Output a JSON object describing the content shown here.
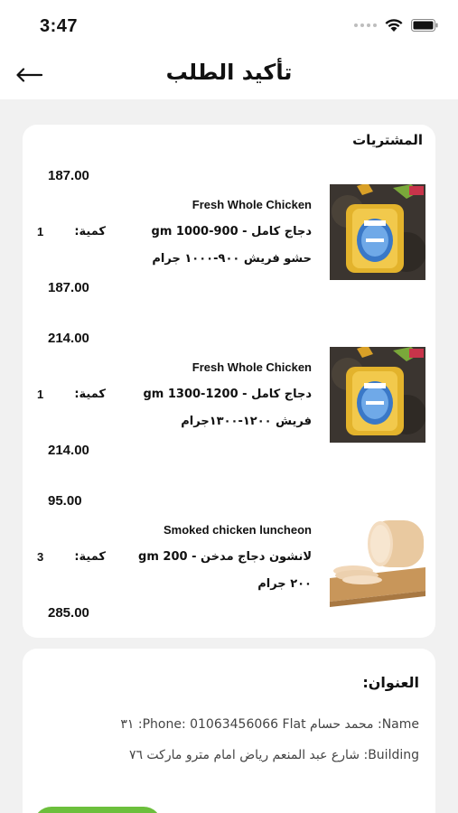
{
  "status_bar": {
    "time": "3:47"
  },
  "header": {
    "title": "تأكيد الطلب"
  },
  "products_section": {
    "title": "المشتريات",
    "items": [
      {
        "price_top": "187.00",
        "name_en": "Fresh Whole Chicken",
        "name_ar_line1": "دجاج كامل - 900-1000 gm",
        "name_ar_line2": "حشو فريش ٩٠٠-١٠٠٠ جرام",
        "qty_label": "كمية:",
        "qty_value": "1",
        "price_bottom": "187.00",
        "image": "whole-chicken-package"
      },
      {
        "price_top": "214.00",
        "name_en": "Fresh Whole Chicken",
        "name_ar_line1": "دجاج كامل - 1200-1300 gm",
        "name_ar_line2": "فريش ١٢٠٠-١٣٠٠جرام",
        "qty_label": "كمية:",
        "qty_value": "1",
        "price_bottom": "214.00",
        "image": "whole-chicken-package"
      },
      {
        "price_top": "95.00",
        "name_en": "Smoked chicken luncheon",
        "name_ar_line1": "لانشون دجاج مدخن - 200 gm",
        "name_ar_line2": "٢٠٠ جرام",
        "qty_label": "كمية:",
        "qty_value": "3",
        "price_bottom": "285.00",
        "image": "smoked-luncheon"
      }
    ]
  },
  "address_section": {
    "title": "العنوان:",
    "line1": "Name: محمد حسام   Phone: 01063456066  Flat: ٣١",
    "line2": "Building: شارع عبد المنعم رياض امام مترو ماركت  ٧٦"
  },
  "colors": {
    "accent": "#6cbf3c",
    "background": "#f1f1f1"
  }
}
